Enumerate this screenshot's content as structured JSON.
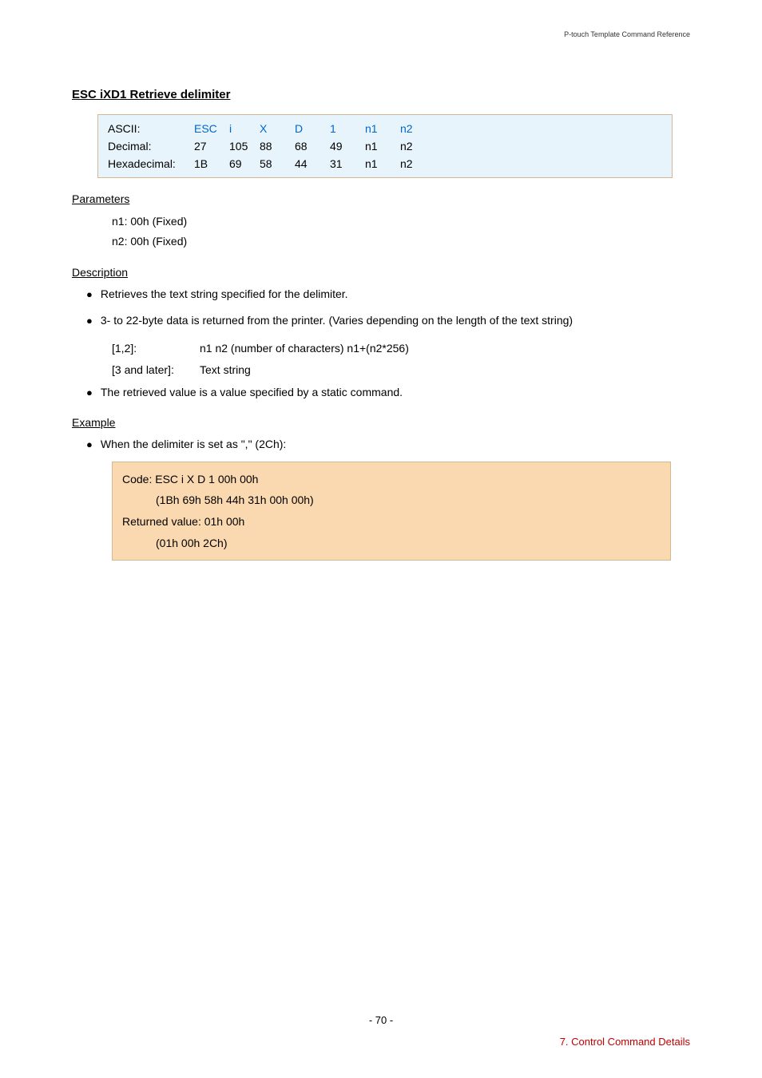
{
  "header": {
    "doc_title": "P-touch Template Command Reference"
  },
  "title": "ESC iXD1   Retrieve delimiter",
  "code_table": {
    "rows": [
      {
        "label": "ASCII:",
        "vals": [
          "ESC",
          "i",
          "X",
          "D",
          "1",
          "n1",
          "n2"
        ],
        "ascii": true
      },
      {
        "label": "Decimal:",
        "vals": [
          "27",
          "105",
          "88",
          "68",
          "49",
          "n1",
          "n2"
        ],
        "ascii": false
      },
      {
        "label": "Hexadecimal:",
        "vals": [
          "1B",
          "69",
          "58",
          "44",
          "31",
          "n1",
          "n2"
        ],
        "ascii": false
      }
    ]
  },
  "parameters": {
    "heading": "Parameters",
    "lines": [
      "n1: 00h (Fixed)",
      "n2: 00h (Fixed)"
    ]
  },
  "description": {
    "heading": "Description",
    "bullets": [
      "Retrieves the text string specified for the delimiter.",
      "3- to 22-byte data is returned from the printer. (Varies depending on the length of the text string)"
    ],
    "sub": [
      {
        "k": "[1,2]:",
        "v": "n1 n2 (number of characters) n1+(n2*256)"
      },
      {
        "k": "[3 and later]:",
        "v": "Text string"
      }
    ],
    "bullet3": "The retrieved value is a value specified by a static command."
  },
  "example": {
    "heading": "Example",
    "bullet": "When the delimiter is set as \",\" (2Ch):",
    "box": {
      "l1": "Code: ESC i X D 1 00h 00h",
      "l2": "(1Bh 69h 58h 44h 31h 00h 00h)",
      "l3": "Returned value: 01h 00h",
      "l4": "(01h 00h 2Ch)"
    }
  },
  "footer": {
    "page": "- 70 -",
    "section": "7. Control Command Details"
  }
}
